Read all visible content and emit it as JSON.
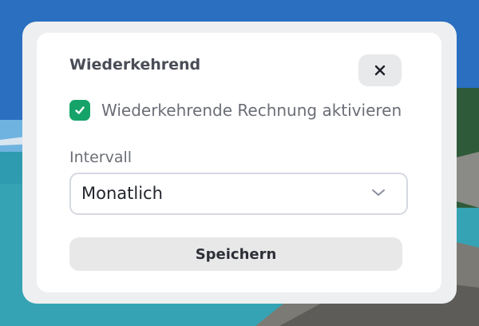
{
  "modal": {
    "title": "Wiederkehrend",
    "close_icon": "close-icon",
    "checkbox": {
      "checked": true,
      "label": "Wiederkehrende Rechnung aktivieren",
      "color": "#16a369"
    },
    "interval": {
      "label": "Intervall",
      "value": "Monatlich",
      "icon": "chevron-down-icon"
    },
    "save_label": "Speichern"
  }
}
